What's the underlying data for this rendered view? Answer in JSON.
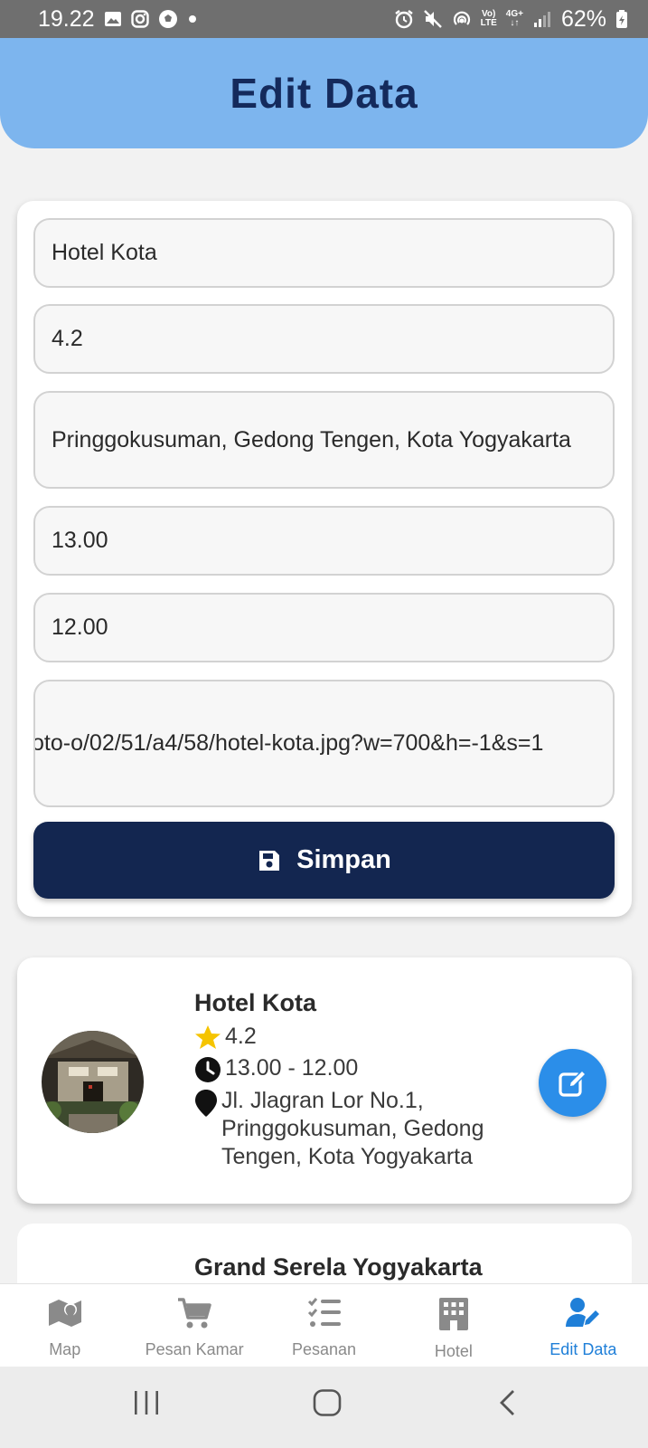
{
  "status_bar": {
    "time": "19.22",
    "network_top": "Vo)",
    "network_bottom": "LTE",
    "signal_type": "4G+",
    "battery": "62%"
  },
  "header": {
    "title": "Edit Data"
  },
  "form": {
    "name_value": "Hotel Kota",
    "rating_value": "4.2",
    "address_value": "Pringgokusuman, Gedong Tengen, Kota Yogyakarta",
    "checkin_value": "13.00",
    "checkout_value": "12.00",
    "image_url_value": "oto-o/02/51/a4/58/hotel-kota.jpg?w=700&h=-1&s=1",
    "save_label": "Simpan"
  },
  "hotels": [
    {
      "name": "Hotel Kota",
      "rating": "4.2",
      "hours": "13.00 - 12.00",
      "address": "Jl. Jlagran Lor No.1, Pringgokusuman, Gedong Tengen, Kota Yogyakarta"
    },
    {
      "name": "Grand Serela Yogyakarta"
    }
  ],
  "nav": {
    "items": [
      {
        "label": "Map",
        "icon": "map-icon"
      },
      {
        "label": "Pesan Kamar",
        "icon": "cart-icon"
      },
      {
        "label": "Pesanan",
        "icon": "checklist-icon"
      },
      {
        "label": "Hotel",
        "icon": "building-icon"
      },
      {
        "label": "Edit Data",
        "icon": "user-edit-icon"
      }
    ],
    "active": "Edit Data"
  },
  "colors": {
    "header_bg": "#7db5ee",
    "title": "#142a5c",
    "primary_button": "#132650",
    "accent": "#2b8ee9",
    "active_nav": "#1f7fd8",
    "star": "#f5c400"
  }
}
